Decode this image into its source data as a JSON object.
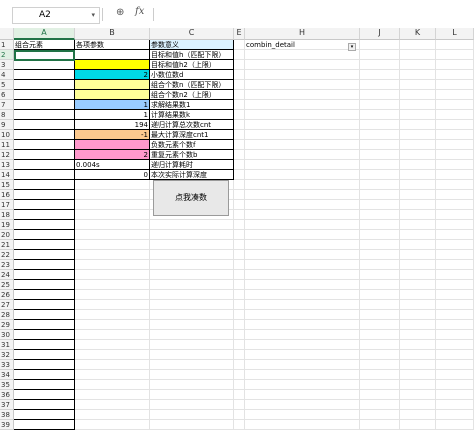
{
  "formula_bar": {
    "name_box": "A2",
    "zoom_glyph": "⊕",
    "fx_label": "fx",
    "dropdown": "▾"
  },
  "columns": [
    {
      "id": "corner",
      "label": ""
    },
    {
      "id": "A",
      "label": "A"
    },
    {
      "id": "B",
      "label": "B"
    },
    {
      "id": "C",
      "label": "C"
    },
    {
      "id": "E",
      "label": "E"
    },
    {
      "id": "H",
      "label": "H"
    },
    {
      "id": "J",
      "label": "J"
    },
    {
      "id": "K",
      "label": "K"
    },
    {
      "id": "L",
      "label": "L"
    }
  ],
  "headers": {
    "A1": "组合元素",
    "B1": "各项参数",
    "C1": "参数意义",
    "H1": "combin_detail"
  },
  "rows": [
    {
      "b": "",
      "c": "目标和值h（匹配下限）"
    },
    {
      "b": "",
      "c": "目标和值h2（上限）"
    },
    {
      "b": "2",
      "c": "小数位数d"
    },
    {
      "b": "",
      "c": "组合个数n（匹配下限）"
    },
    {
      "b": "",
      "c": "组合个数n2（上限）"
    },
    {
      "b": "1",
      "c": "求解结果数1"
    },
    {
      "b": "1",
      "c": "计算结果数k"
    },
    {
      "b": "194",
      "c": "递归计算总次数cnt"
    },
    {
      "b": "-1",
      "c": "最大计算深度cnt1"
    },
    {
      "b": "",
      "c": "负数元素个数f"
    },
    {
      "b": "2",
      "c": "重复元素个数b"
    },
    {
      "b": "0.004s",
      "c": "递归计算耗时"
    },
    {
      "b": "0",
      "c": "本次实际计算深度"
    }
  ],
  "row_colors": [
    "#ffffff",
    "#ffff00",
    "#00d9e6",
    "#ffff99",
    "#ffff99",
    "#99ccff",
    "#ffffff",
    "#ffffff",
    "#fbc98e",
    "#ff99cc",
    "#ff99cc",
    "#ffffff",
    "#ffffff"
  ],
  "button": {
    "label": "点我凑数"
  },
  "colors": {
    "accent": "#217346",
    "selected_header": "#e1f0e3"
  }
}
